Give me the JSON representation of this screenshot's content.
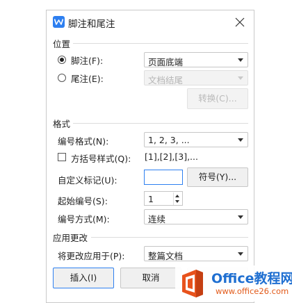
{
  "dialog": {
    "title": "脚注和尾注",
    "icon": "wps-writer-icon"
  },
  "location": {
    "section_title": "位置",
    "footnote": {
      "label": "脚注(F):",
      "checked": true,
      "value": "页面底端"
    },
    "endnote": {
      "label": "尾注(E):",
      "checked": false,
      "value": "文档结尾"
    },
    "convert_button": "转换(C)..."
  },
  "format": {
    "section_title": "格式",
    "number_format": {
      "label": "编号格式(N):",
      "value": "1, 2, 3, ..."
    },
    "bracket_style": {
      "label": "方括号样式(Q):",
      "checked": false,
      "preview": "[1],[2],[3],..."
    },
    "custom_mark": {
      "label": "自定义标记(U):",
      "value": ""
    },
    "symbol_button": "符号(Y)...",
    "start_at": {
      "label": "起始编号(S):",
      "value": "1"
    },
    "numbering": {
      "label": "编号方式(M):",
      "value": "连续"
    }
  },
  "apply": {
    "section_title": "应用更改",
    "apply_to": {
      "label": "将更改应用于(P):",
      "value": "整篇文档"
    }
  },
  "buttons": {
    "insert": "插入(I)",
    "cancel": "取消"
  },
  "watermark": {
    "title": "Office教程网",
    "url": "www.office26.com"
  },
  "colors": {
    "accent": "#2d7ff0",
    "watermark_blue": "#1f6fd1",
    "watermark_orange": "#e25b1b"
  }
}
